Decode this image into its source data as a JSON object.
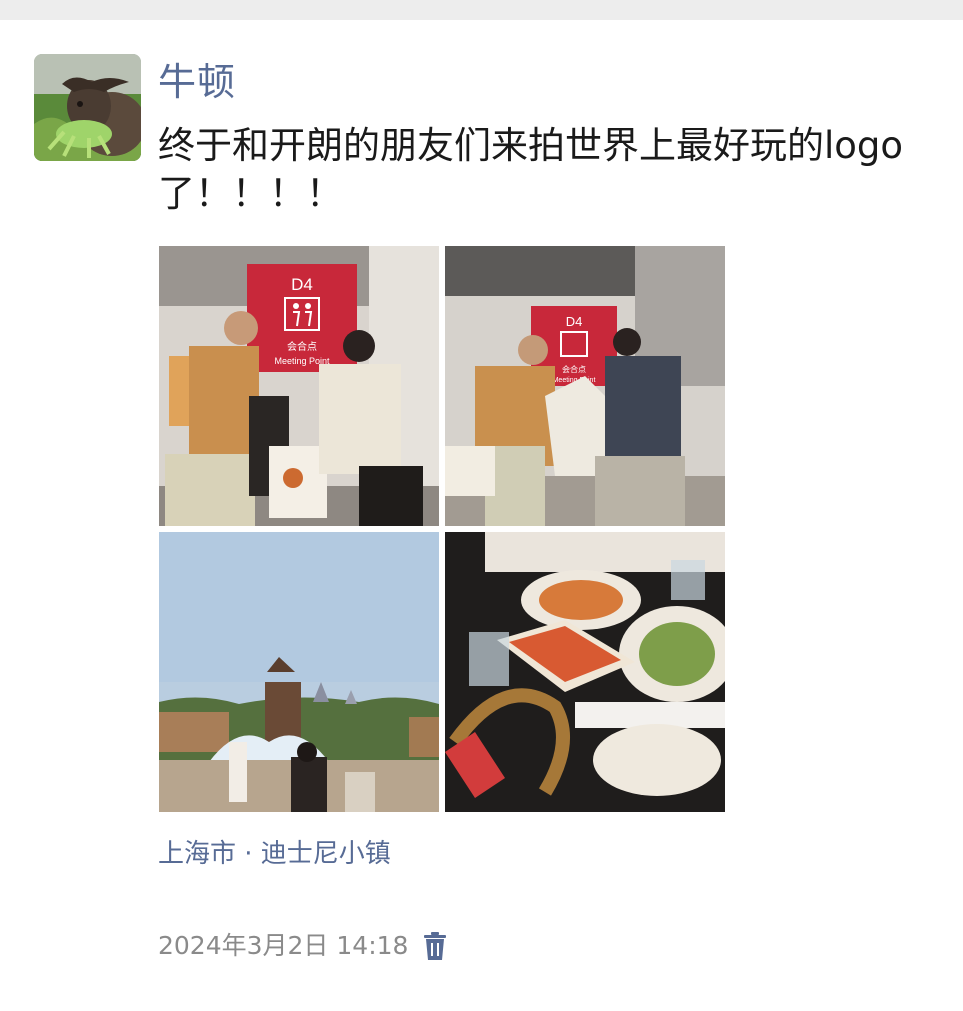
{
  "post": {
    "username": "牛顿",
    "text_line1": "终于和开朗的朋友们来拍世界上最好玩的logo",
    "text_line2": "了！！！！",
    "location": "上海市 · 迪士尼小镇",
    "timestamp": "2024年3月2日 14:18"
  },
  "photos": [
    {
      "sign_title": "D4",
      "sign_text": "会合点",
      "sign_subtext": "Meeting Point",
      "description": "photo-meeting-point-1"
    },
    {
      "sign_title": "D4",
      "sign_text": "会合点",
      "sign_subtext": "Meeting Point",
      "description": "photo-meeting-point-2"
    },
    {
      "description": "photo-disney-town-fountain"
    },
    {
      "description": "photo-restaurant-table"
    }
  ],
  "icons": {
    "delete": "trash-icon"
  },
  "colors": {
    "link": "#576b95",
    "text": "#1a1a1a",
    "meta": "#8a8a8a",
    "sign_red": "#c8283a",
    "background": "#ffffff"
  }
}
